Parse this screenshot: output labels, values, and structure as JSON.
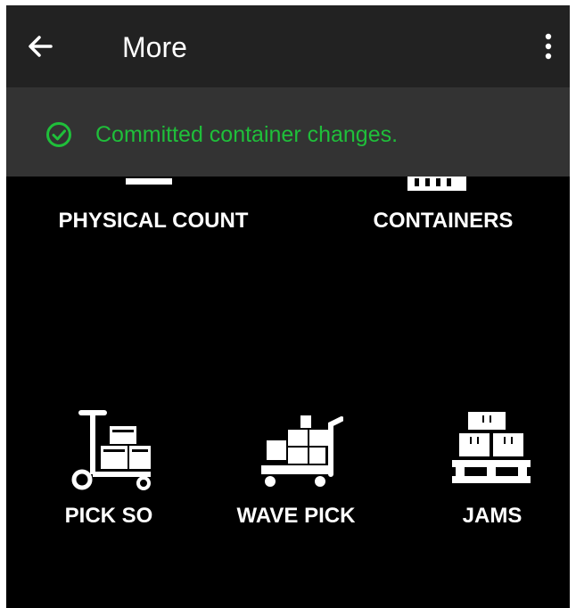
{
  "appbar": {
    "title": "More",
    "back_icon": "arrow-left-icon",
    "menu_icon": "more-vert-icon"
  },
  "snackbar": {
    "message": "Committed container changes.",
    "icon": "check-circle-icon",
    "color": "#1fbf3a"
  },
  "tiles": [
    {
      "label": "PHYSICAL COUNT",
      "icon": "scale-icon"
    },
    {
      "label": "CONTAINERS",
      "icon": "crate-icon"
    },
    {
      "label": "PICK SO",
      "icon": "hand-truck-icon"
    },
    {
      "label": "WAVE PICK",
      "icon": "cart-icon"
    },
    {
      "label": "JAMS",
      "icon": "pallet-icon"
    }
  ]
}
